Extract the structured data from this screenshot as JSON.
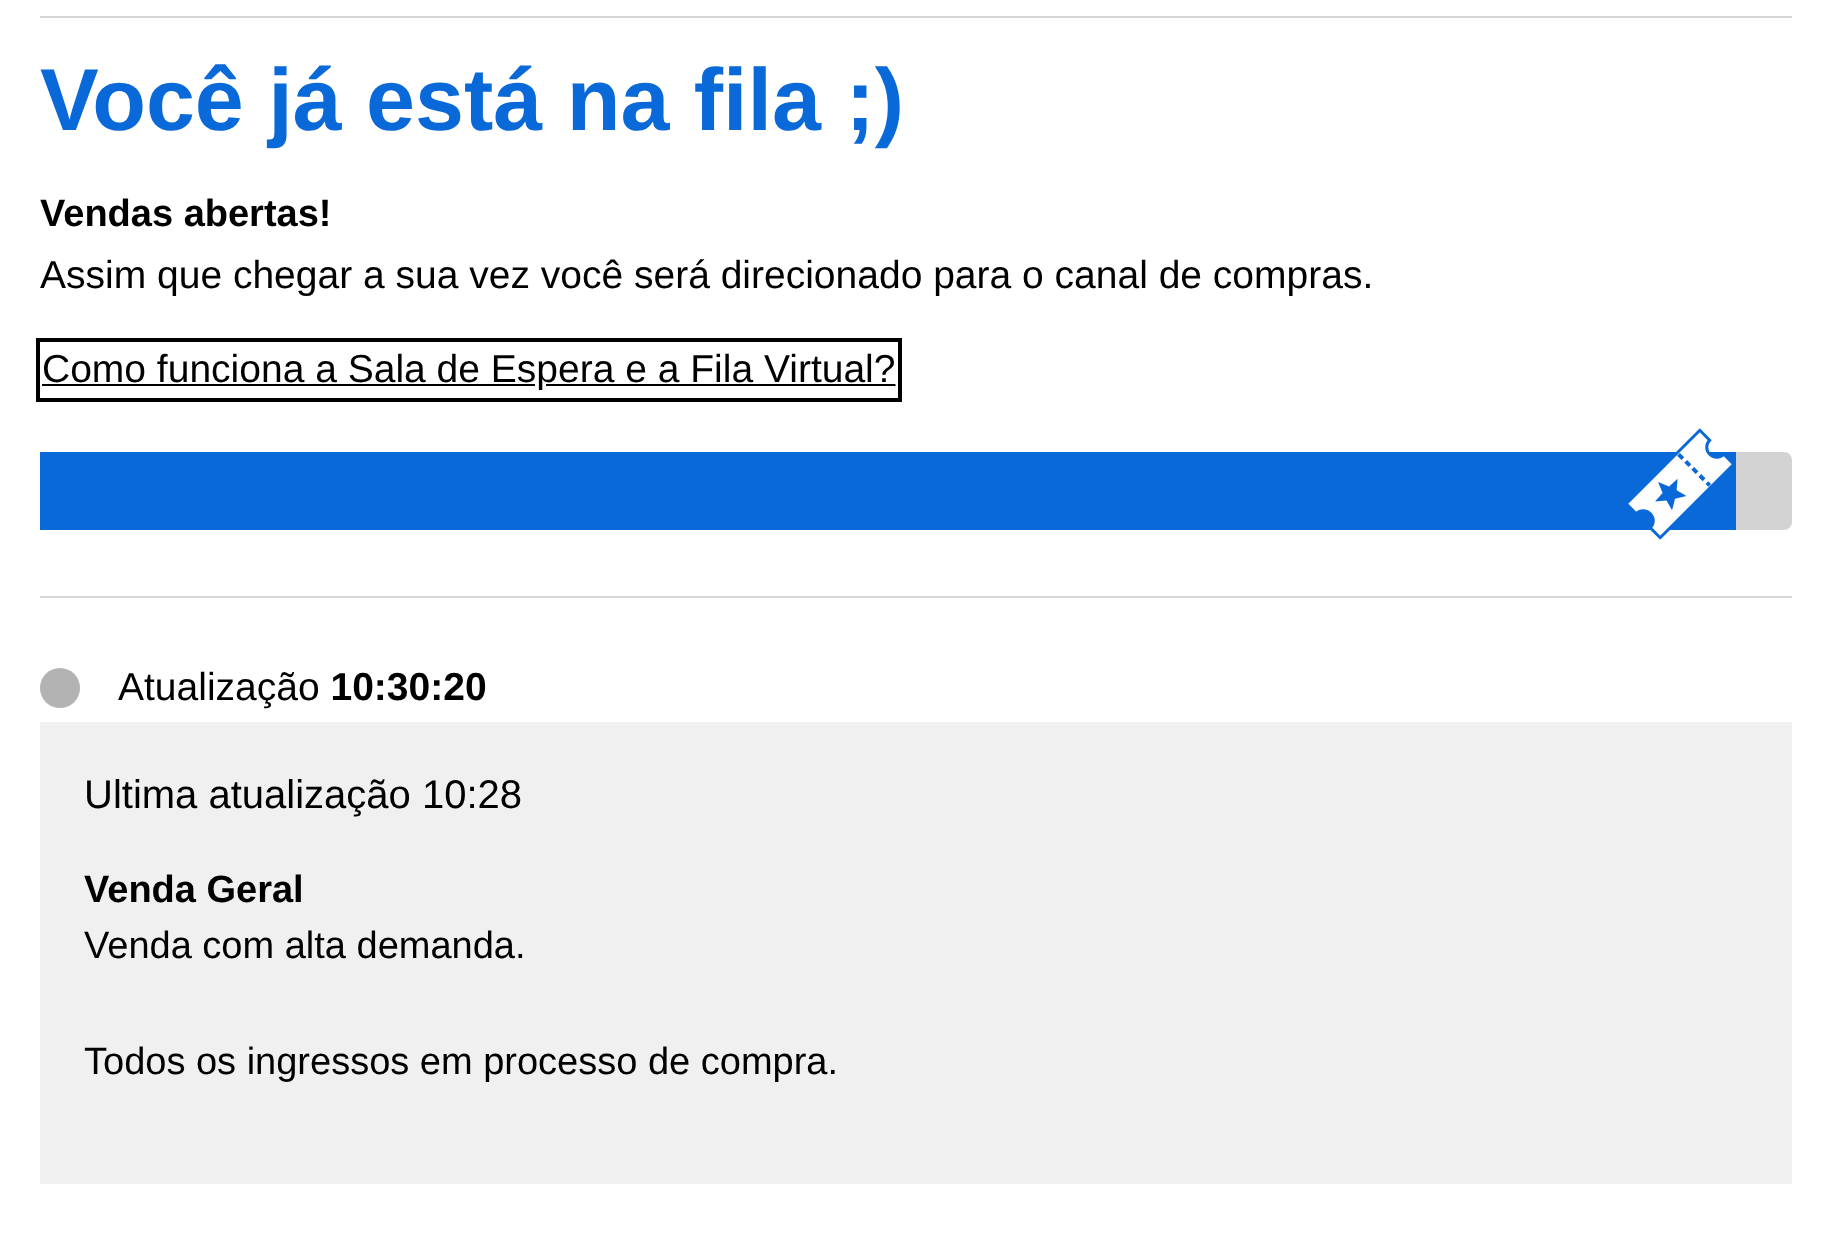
{
  "page": {
    "title": "Você já está na fila ;)",
    "status_heading": "Vendas abertas!",
    "message": "Assim que chegar a sua vez você será direcionado para o canal de compras.",
    "help_link": "Como funciona a Sala de Espera e a Fila Virtual?"
  },
  "progress": {
    "level": 0.968
  },
  "update": {
    "text": "Atualização **10:30:20**"
  },
  "panel": {
    "last_update": "Ultima atualização 10:28",
    "sale_title": "Venda Geral",
    "paragraphs": [
      "Venda com alta demanda.",
      "Todos os ingressos em processo de compra."
    ]
  }
}
